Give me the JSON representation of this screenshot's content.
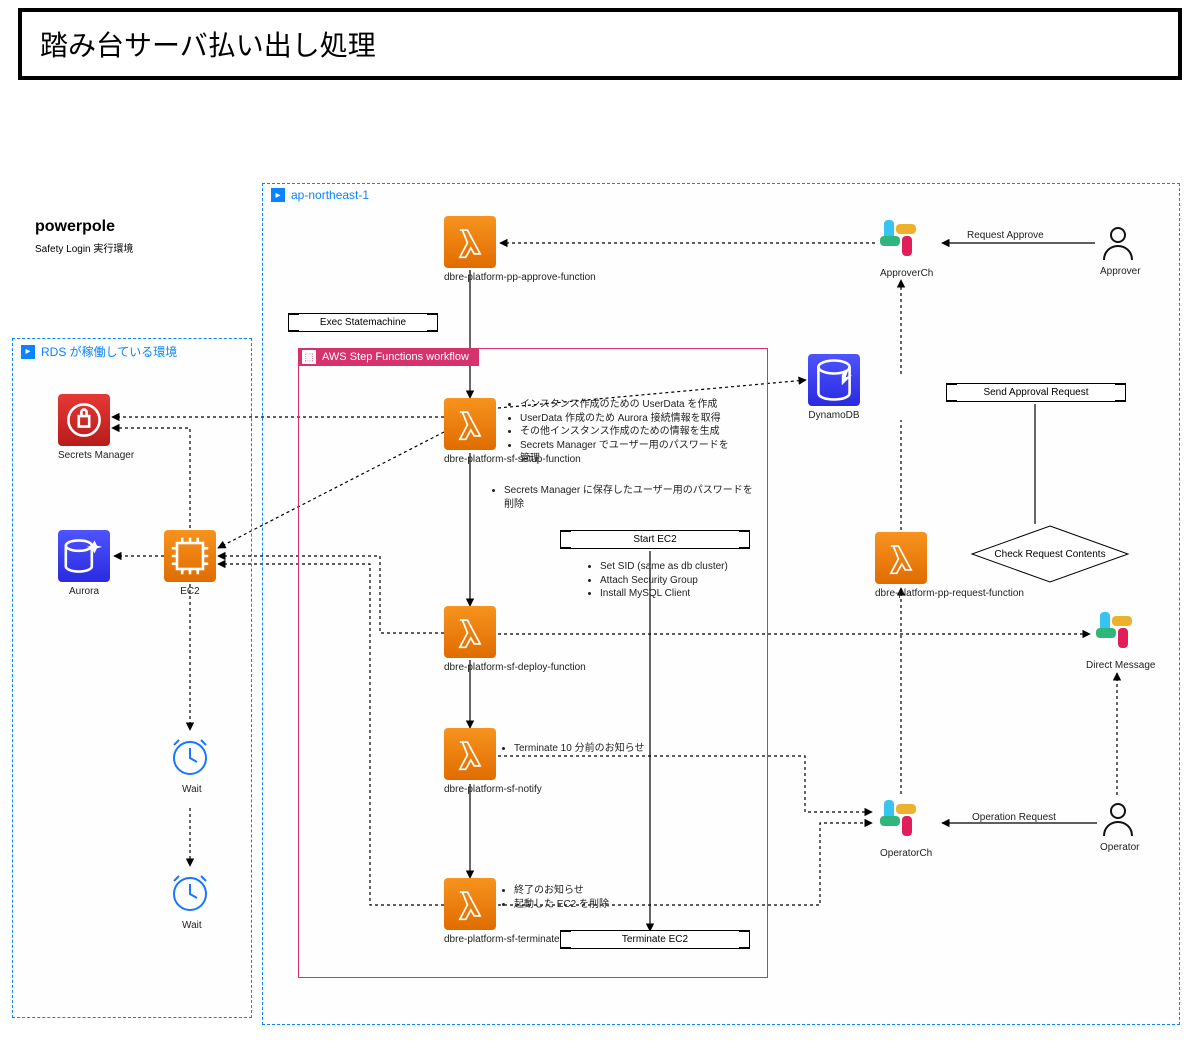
{
  "title": "踏み台サーバ払い出し処理",
  "powerpole": {
    "name": "powerpole",
    "subtitle": "Safety Login 実行環境"
  },
  "regions": {
    "main": {
      "label": "ap-northeast-1"
    },
    "rds_env": {
      "label": "RDS が稼働している環境"
    }
  },
  "step_functions": {
    "label": "AWS Step Functions workflow"
  },
  "lambdas": {
    "approve": "dbre-platform-pp-approve-function",
    "setup": "dbre-platform-sf-setup-function",
    "deploy": "dbre-platform-sf-deploy-function",
    "notify": "dbre-platform-sf-notify",
    "terminate": "dbre-platform-sf-terminate-function",
    "request": "dbre-platform-pp-request-function"
  },
  "services": {
    "secrets": "Secrets Manager",
    "aurora": "Aurora",
    "ec2": "EC2",
    "dynamo": "DynamoDB"
  },
  "slack": {
    "approver_ch": "ApproverCh",
    "operator_ch": "OperatorCh",
    "dm": "Direct Message"
  },
  "people": {
    "approver": "Approver",
    "operator": "Operator"
  },
  "waits": {
    "wait1": "Wait",
    "wait2": "Wait"
  },
  "pills": {
    "exec_sm": "Exec Statemachine",
    "start_ec2": "Start EC2",
    "terminate_ec2": "Terminate EC2",
    "send_approval": "Send Approval Request"
  },
  "diamond": "Check Request Contents",
  "edge_labels": {
    "request_approve": "Request Approve",
    "operation_request": "Operation Request"
  },
  "notes": {
    "setup": [
      "インスタンス作成のための UserData を作成",
      "UserData 作成のため Aurora 接続情報を取得",
      "その他インスタンス作成のための情報を生成",
      "Secrets Manager でユーザー用のパスワードを管理"
    ],
    "setup_below": [
      "Secrets Manager に保存したユーザー用のパスワードを削除"
    ],
    "start_ec2": [
      "Set SID (same as db cluster)",
      "Attach Security Group",
      "Install MySQL Client"
    ],
    "notify": [
      "Terminate 10 分前のお知らせ"
    ],
    "terminate": [
      "終了のお知らせ",
      "起動した EC2 を削除"
    ]
  }
}
